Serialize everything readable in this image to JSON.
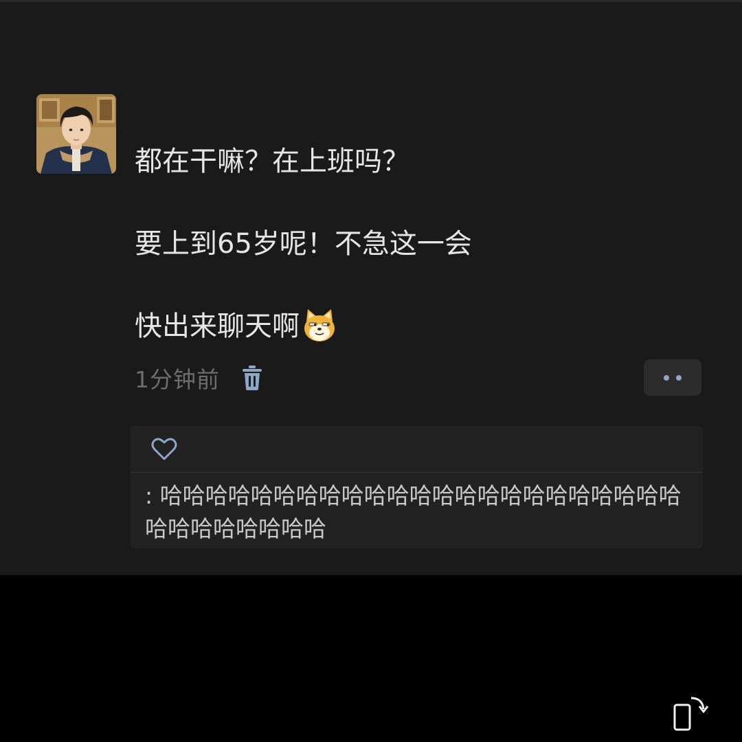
{
  "post": {
    "lines": [
      "都在干嘛？在上班吗？",
      "要上到65岁呢！不急这一会",
      "快出来聊天啊"
    ],
    "emoji": "doge-cat-emoji",
    "time": "1分钟前",
    "icons": {
      "delete": "trash-icon",
      "more": "more-dots-icon"
    }
  },
  "comments": {
    "like_icon": "heart-outline-icon",
    "items": [
      {
        "prefix": ":",
        "text": "哈哈哈哈哈哈哈哈哈哈哈哈哈哈哈哈哈哈哈哈哈哈哈哈哈哈哈哈哈哈哈"
      }
    ]
  },
  "system": {
    "rotate_icon": "screen-rotate-icon"
  },
  "colors": {
    "page_background": "#000000",
    "card_background": "#1a1a1a",
    "text": "#e6e6e6",
    "muted_text": "#6d6d6d",
    "accent_blue": "#8ea7c7",
    "comment_background": "#222222"
  }
}
